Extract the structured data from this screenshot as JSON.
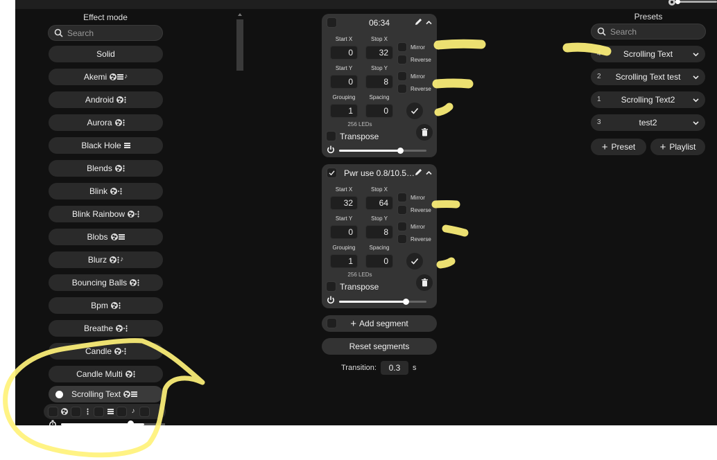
{
  "effects": {
    "title": "Effect mode",
    "search_placeholder": "Search",
    "items": [
      {
        "label": "Solid",
        "icons": []
      },
      {
        "label": "Akemi",
        "icons": [
          "palette",
          "grid",
          "note"
        ]
      },
      {
        "label": "Android",
        "icons": [
          "palette",
          "dots"
        ]
      },
      {
        "label": "Aurora",
        "icons": [
          "palette",
          "dots"
        ]
      },
      {
        "label": "Black Hole",
        "icons": [
          "grid"
        ]
      },
      {
        "label": "Blends",
        "icons": [
          "palette",
          "dots"
        ]
      },
      {
        "label": "Blink",
        "icons": [
          "palette",
          "dots2"
        ]
      },
      {
        "label": "Blink Rainbow",
        "icons": [
          "palette",
          "dots2"
        ]
      },
      {
        "label": "Blobs",
        "icons": [
          "palette",
          "grid"
        ]
      },
      {
        "label": "Blurz",
        "icons": [
          "palette",
          "dots",
          "note"
        ]
      },
      {
        "label": "Bouncing Balls",
        "icons": [
          "palette",
          "dots"
        ]
      },
      {
        "label": "Bpm",
        "icons": [
          "palette",
          "dots"
        ]
      },
      {
        "label": "Breathe",
        "icons": [
          "palette",
          "dots2"
        ]
      },
      {
        "label": "Candle",
        "icons": [
          "palette",
          "dots2"
        ]
      },
      {
        "label": "Candle Multi",
        "icons": [
          "palette",
          "dots"
        ]
      }
    ],
    "selected": {
      "label": "Scrolling Text",
      "icons": [
        "palette",
        "grid"
      ]
    },
    "speed": 0.8
  },
  "segments": [
    {
      "name": "06:34",
      "selected": false,
      "start_x_label": "Start X",
      "start_x": "0",
      "stop_x_label": "Stop X",
      "stop_x": "32",
      "start_y_label": "Start Y",
      "start_y": "0",
      "stop_y_label": "Stop Y",
      "stop_y": "8",
      "grouping_label": "Grouping",
      "grouping": "1",
      "spacing_label": "Spacing",
      "spacing": "0",
      "mirror_x": "Mirror",
      "reverse_x": "Reverse",
      "mirror_y": "Mirror",
      "reverse_y": "Reverse",
      "leds": "256 LEDs",
      "transpose": "Transpose",
      "brightness": 0.7
    },
    {
      "name": "Pwr use 0.8/10.5…",
      "selected": true,
      "start_x_label": "Start X",
      "start_x": "32",
      "stop_x_label": "Stop X",
      "stop_x": "64",
      "start_y_label": "Start Y",
      "start_y": "0",
      "stop_y_label": "Stop Y",
      "stop_y": "8",
      "grouping_label": "Grouping",
      "grouping": "1",
      "spacing_label": "Spacing",
      "spacing": "0",
      "mirror_x": "Mirror",
      "reverse_x": "Reverse",
      "mirror_y": "Mirror",
      "reverse_y": "Reverse",
      "leds": "256 LEDs",
      "transpose": "Transpose",
      "brightness": 0.76
    }
  ],
  "segment_actions": {
    "add": "Add segment",
    "reset": "Reset segments",
    "transition_label": "Transition:",
    "transition_value": "0.3",
    "transition_unit": "s"
  },
  "presets": {
    "title": "Presets",
    "search_placeholder": "Search",
    "items": [
      {
        "id": "4",
        "name": "Scrolling Text"
      },
      {
        "id": "2",
        "name": "Scrolling Text test"
      },
      {
        "id": "1",
        "name": "Scrolling Text2"
      },
      {
        "id": "3",
        "name": "test2"
      }
    ],
    "add_preset": "Preset",
    "add_playlist": "Playlist"
  },
  "colors": {
    "background": "#111111",
    "panel": "#2a2a2a",
    "segment": "#343434",
    "highlight": "#fff27a"
  }
}
